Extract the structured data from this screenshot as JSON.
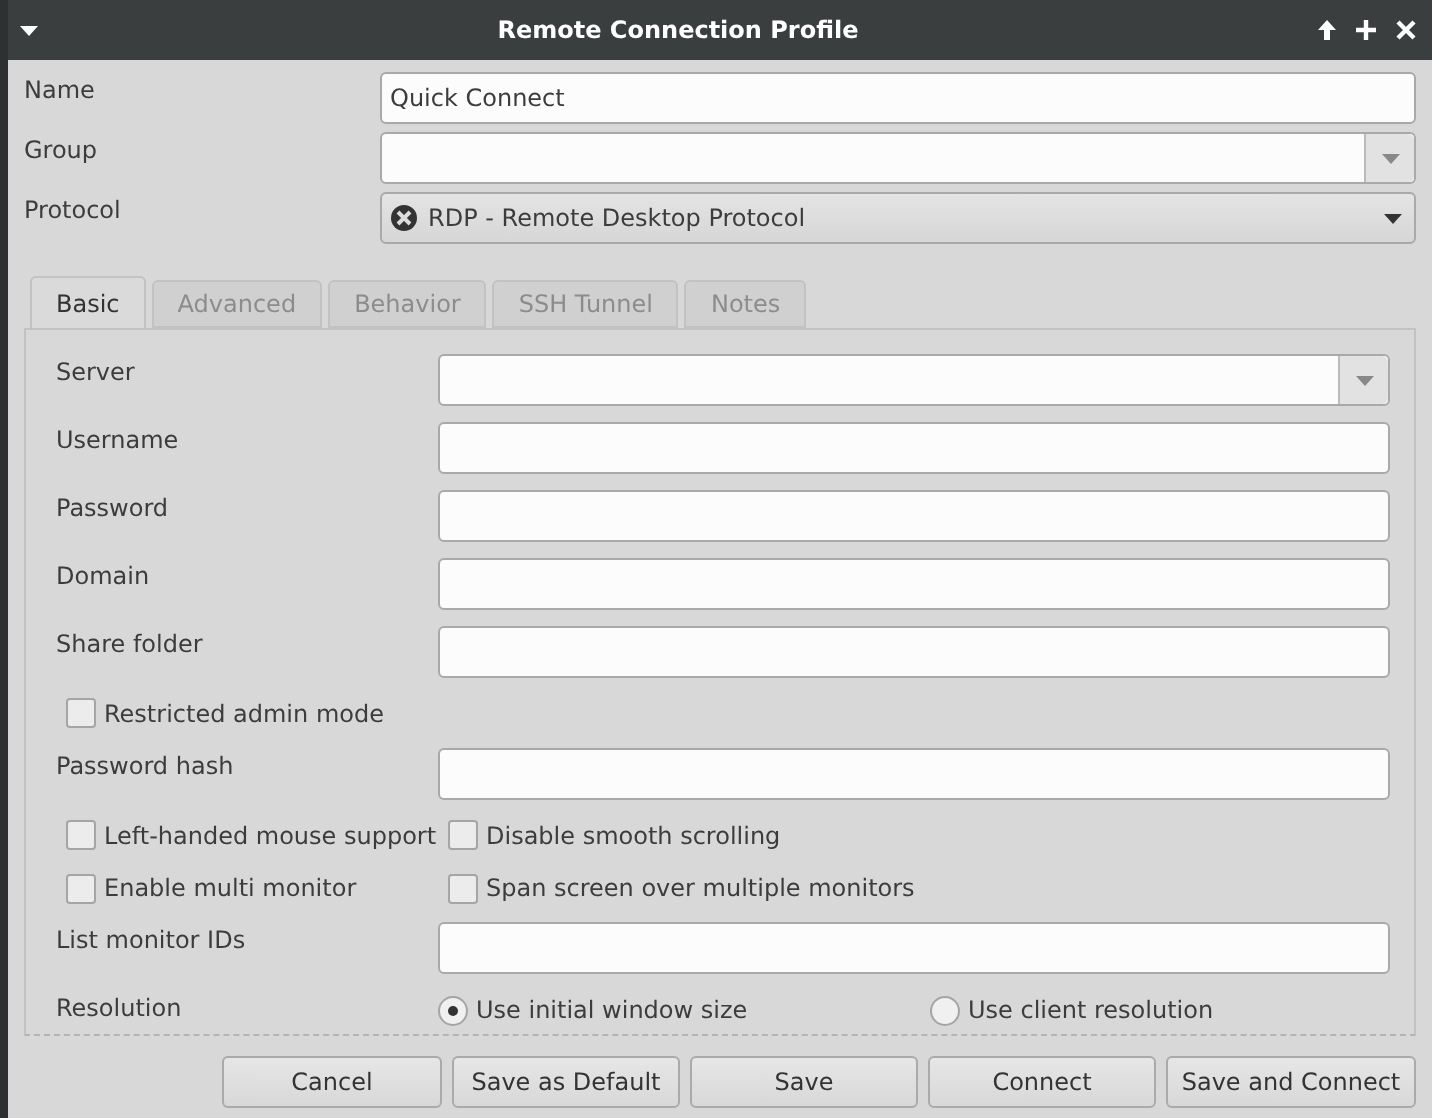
{
  "window": {
    "title": "Remote Connection Profile"
  },
  "top_fields": [
    {
      "label": "Name",
      "kind": "entry",
      "value": "Quick Connect"
    },
    {
      "label": "Group",
      "kind": "combo"
    },
    {
      "label": "Protocol",
      "kind": "dropdown",
      "value": "RDP - Remote Desktop Protocol"
    }
  ],
  "tabs": [
    {
      "label": "Basic",
      "selected": true
    },
    {
      "label": "Advanced",
      "selected": false
    },
    {
      "label": "Behavior",
      "selected": false
    },
    {
      "label": "SSH Tunnel",
      "selected": false
    },
    {
      "label": "Notes",
      "selected": false
    }
  ],
  "rows": [
    {
      "kind": "combo",
      "label": "Server"
    },
    {
      "kind": "entry",
      "label": "Username"
    },
    {
      "kind": "entry",
      "label": "Password"
    },
    {
      "kind": "entry",
      "label": "Domain"
    },
    {
      "kind": "entry",
      "label": "Share folder"
    },
    {
      "kind": "checks",
      "options": [
        {
          "label": "Restricted admin mode",
          "checked": false
        }
      ]
    },
    {
      "kind": "entry",
      "label": "Password hash"
    },
    {
      "kind": "checks",
      "options": [
        {
          "label": "Left-handed mouse support",
          "checked": false
        },
        {
          "label": "Disable smooth scrolling",
          "checked": false
        }
      ]
    },
    {
      "kind": "checks",
      "options": [
        {
          "label": "Enable multi monitor",
          "checked": false
        },
        {
          "label": "Span screen over multiple monitors",
          "checked": false
        }
      ]
    },
    {
      "kind": "entry",
      "label": "List monitor IDs"
    },
    {
      "kind": "radios",
      "label": "Resolution",
      "options": [
        {
          "label": "Use initial window size",
          "selected": true
        },
        {
          "label": "Use client resolution",
          "selected": false
        }
      ]
    }
  ],
  "buttons": [
    "Cancel",
    "Save as Default",
    "Save",
    "Connect",
    "Save and Connect"
  ]
}
